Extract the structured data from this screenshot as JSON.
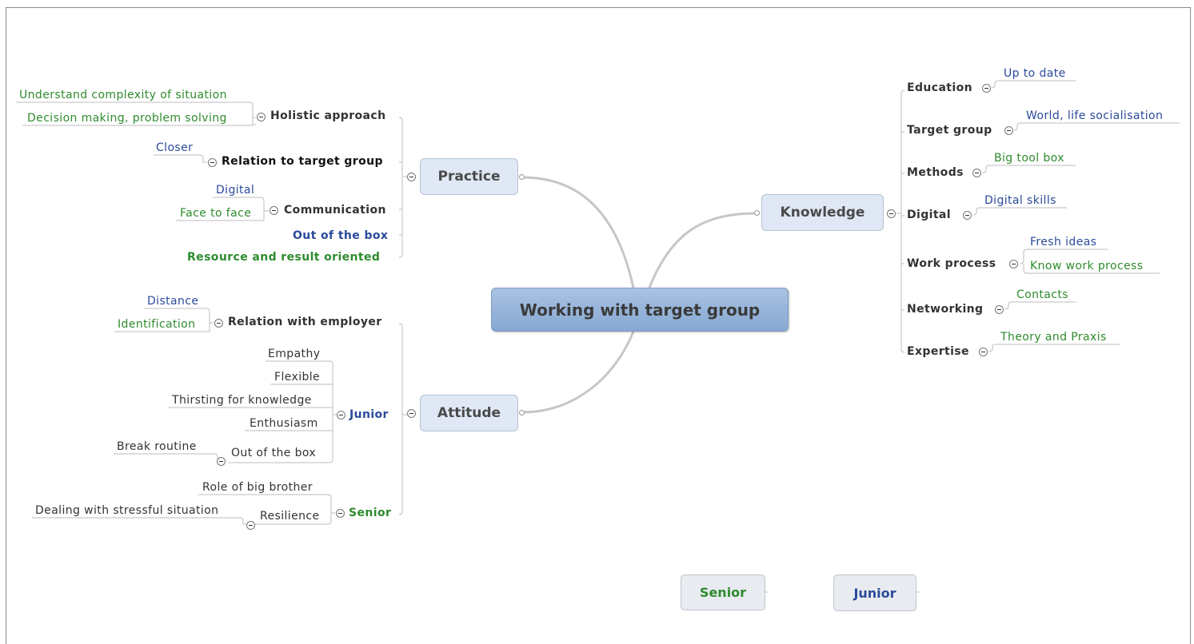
{
  "central": "Working with target group",
  "main": {
    "practice": "Practice",
    "attitude": "Attitude",
    "knowledge": "Knowledge"
  },
  "practice": {
    "holistic": {
      "label": "Holistic approach",
      "children": [
        "Understand complexity of situation",
        "Decision making, problem solving"
      ]
    },
    "relation": {
      "label": "Relation to target group",
      "children": [
        "Closer"
      ]
    },
    "communication": {
      "label": "Communication",
      "children": [
        "Digital",
        "Face to face"
      ]
    },
    "out_of_box": "Out of the box",
    "resource": "Resource and result oriented"
  },
  "attitude": {
    "employer": {
      "label": "Relation with employer",
      "children": [
        "Distance",
        "Identification"
      ]
    },
    "junior": {
      "label": "Junior",
      "children": [
        "Empathy",
        "Flexible",
        "Thirsting for knowledge",
        "Enthusiasm"
      ],
      "out_of_box": {
        "label": "Out of the box",
        "children": [
          "Break routine"
        ]
      }
    },
    "senior": {
      "label": "Senior",
      "children": [
        "Role of big brother"
      ],
      "resilience": {
        "label": "Resilience",
        "children": [
          "Dealing with stressful situation"
        ]
      }
    }
  },
  "knowledge": {
    "education": {
      "label": "Education",
      "child": "Up to date"
    },
    "target_group": {
      "label": "Target group",
      "child": "World, life socialisation"
    },
    "methods": {
      "label": "Methods",
      "child": "Big tool box"
    },
    "digital": {
      "label": "Digital",
      "child": "Digital skills"
    },
    "work_process": {
      "label": "Work process",
      "children": [
        "Fresh ideas",
        "Know work process"
      ]
    },
    "networking": {
      "label": "Networking",
      "child": "Contacts"
    },
    "expertise": {
      "label": "Expertise",
      "child": "Theory and Praxis"
    }
  },
  "legend": {
    "senior": "Senior",
    "junior": "Junior"
  },
  "colors": {
    "green": "#2e8b2e",
    "blue": "#2a4a9a",
    "central": "#8aabd4",
    "node": "#dfe8f4"
  }
}
